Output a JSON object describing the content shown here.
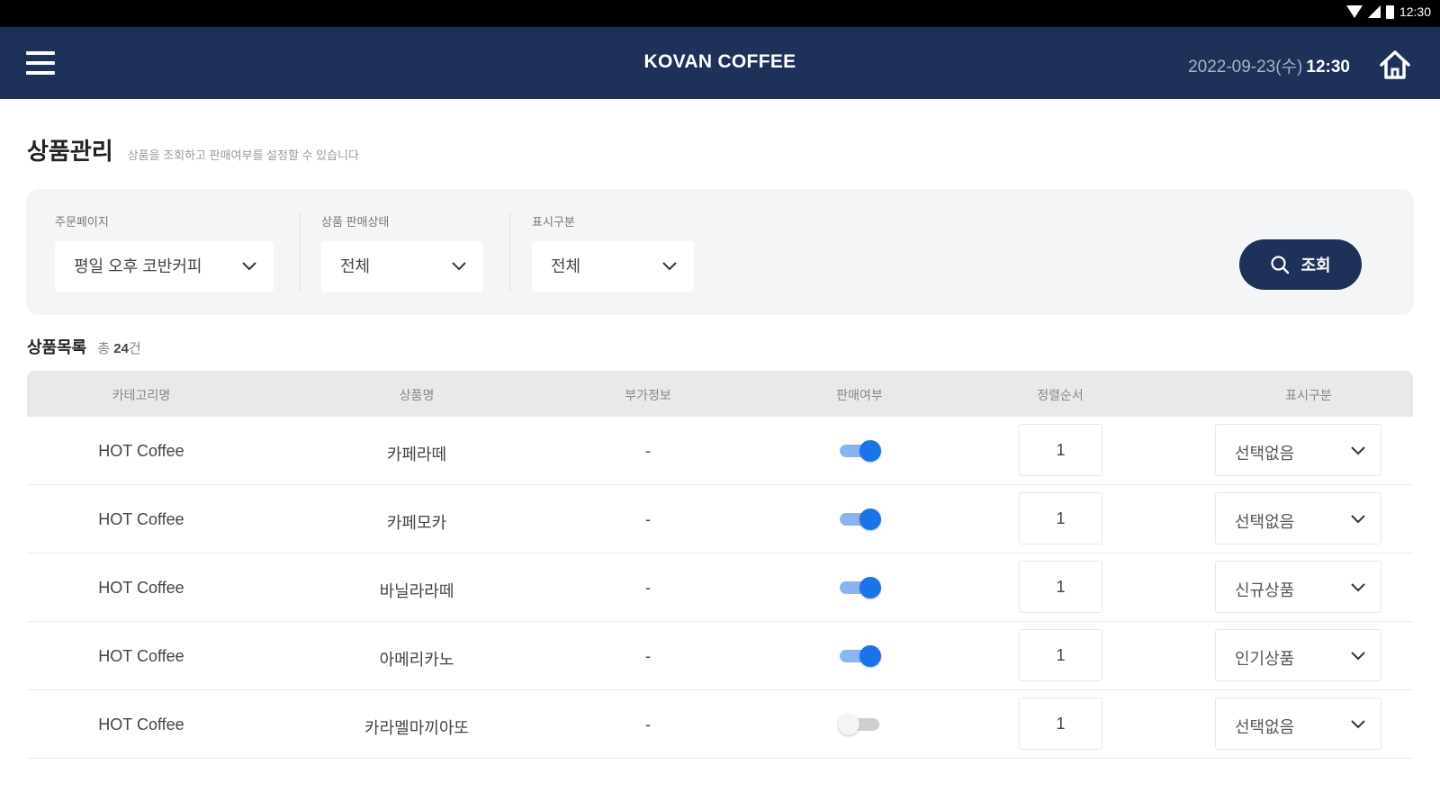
{
  "status_bar": {
    "time": "12:30"
  },
  "header": {
    "title": "KOVAN COFFEE",
    "date": "2022-09-23(수)",
    "time": "12:30"
  },
  "page": {
    "title": "상품관리",
    "description": "상품을 조회하고 판매여부를 설정할 수 있습니다"
  },
  "filters": {
    "order_page": {
      "label": "주문페이지",
      "value": "평일 오후 코반커피"
    },
    "sale_status": {
      "label": "상품 판매상태",
      "value": "전체"
    },
    "display_type": {
      "label": "표시구분",
      "value": "전체"
    },
    "search_label": "조회"
  },
  "product_list": {
    "title": "상품목록",
    "count_prefix": "총",
    "count": "24",
    "count_suffix": "건"
  },
  "table": {
    "columns": [
      "카테고리명",
      "상품명",
      "부가정보",
      "판매여부",
      "정렬순서",
      "표시구분"
    ],
    "rows": [
      {
        "category": "HOT Coffee",
        "name": "카페라떼",
        "extra": "-",
        "on_sale": true,
        "order": "1",
        "display": "선택없음"
      },
      {
        "category": "HOT Coffee",
        "name": "카페모카",
        "extra": "-",
        "on_sale": true,
        "order": "1",
        "display": "선택없음"
      },
      {
        "category": "HOT Coffee",
        "name": "바닐라라떼",
        "extra": "-",
        "on_sale": true,
        "order": "1",
        "display": "신규상품"
      },
      {
        "category": "HOT Coffee",
        "name": "아메리카노",
        "extra": "-",
        "on_sale": true,
        "order": "1",
        "display": "인기상품"
      },
      {
        "category": "HOT Coffee",
        "name": "카라멜마끼아또",
        "extra": "-",
        "on_sale": false,
        "order": "1",
        "display": "선택없음"
      }
    ]
  },
  "colors": {
    "header_bg": "#1e3158",
    "accent": "#1a73e8",
    "toggle_on_track": "#8ab4f0",
    "panel_bg": "#f4f5f7"
  },
  "icons": {
    "menu": "menu-icon",
    "home": "home-icon",
    "search": "search-icon",
    "dropdown": "chevron-down-icon"
  }
}
